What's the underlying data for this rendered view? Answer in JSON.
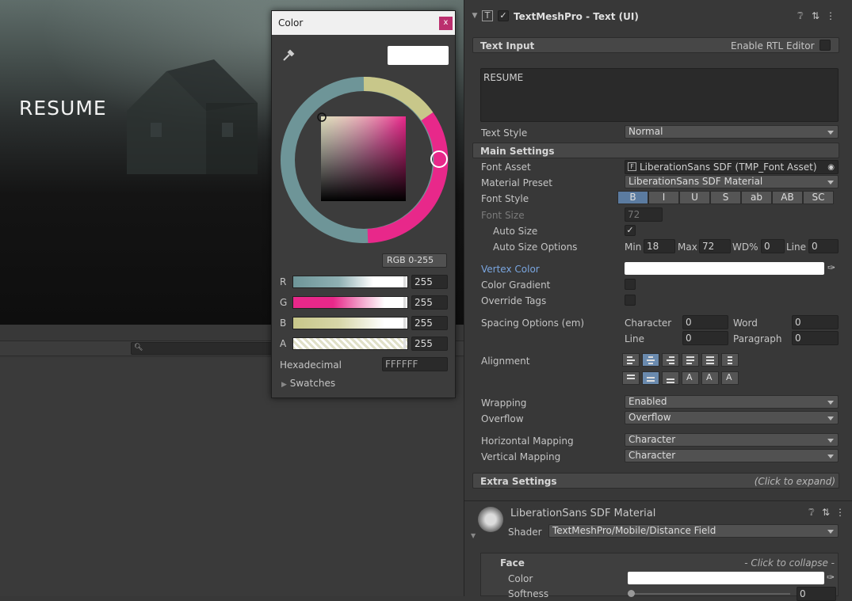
{
  "scene": {
    "overlay_text": "RESUME"
  },
  "color_picker": {
    "title": "Color",
    "close_label": "x",
    "mode": "RGB 0-255",
    "channels": [
      {
        "label": "R",
        "value": "255"
      },
      {
        "label": "G",
        "value": "255"
      },
      {
        "label": "B",
        "value": "255"
      },
      {
        "label": "A",
        "value": "255"
      }
    ],
    "hex_label": "Hexadecimal",
    "hex_value": "FFFFFF",
    "swatches_label": "Swatches",
    "colors": {
      "ring_teal": "#6e9598",
      "ring_yellow": "#c8c78a",
      "ring_pink": "#e8288a"
    }
  },
  "inspector": {
    "component_title": "TextMeshPro - Text (UI)",
    "text_input_header": "Text Input",
    "enable_rtl_label": "Enable RTL Editor",
    "text_value": "RESUME",
    "text_style_label": "Text Style",
    "text_style_value": "Normal",
    "main_settings_header": "Main Settings",
    "font_asset_label": "Font Asset",
    "font_asset_value": "LiberationSans SDF (TMP_Font Asset)",
    "material_preset_label": "Material Preset",
    "material_preset_value": "LiberationSans SDF Material",
    "font_style_label": "Font Style",
    "font_style_buttons": [
      "B",
      "I",
      "U",
      "S",
      "ab",
      "AB",
      "SC"
    ],
    "font_size_label": "Font Size",
    "font_size_value": "72",
    "auto_size_label": "Auto Size",
    "auto_size_options_label": "Auto Size Options",
    "auto_size": {
      "min_label": "Min",
      "min": "18",
      "max_label": "Max",
      "max": "72",
      "wd_label": "WD%",
      "wd": "0",
      "line_label": "Line",
      "line": "0"
    },
    "vertex_color_label": "Vertex Color",
    "color_gradient_label": "Color Gradient",
    "override_tags_label": "Override Tags",
    "spacing_label": "Spacing Options (em)",
    "spacing": {
      "character_label": "Character",
      "character": "0",
      "word_label": "Word",
      "word": "0",
      "line_label": "Line",
      "line": "0",
      "paragraph_label": "Paragraph",
      "paragraph": "0"
    },
    "alignment_label": "Alignment",
    "wrapping_label": "Wrapping",
    "wrapping_value": "Enabled",
    "overflow_label": "Overflow",
    "overflow_value": "Overflow",
    "h_mapping_label": "Horizontal Mapping",
    "h_mapping_value": "Character",
    "v_mapping_label": "Vertical Mapping",
    "v_mapping_value": "Character",
    "extra_settings_header": "Extra Settings",
    "extra_settings_hint": "(Click to expand)",
    "material_title": "LiberationSans SDF Material",
    "shader_label": "Shader",
    "shader_value": "TextMeshPro/Mobile/Distance Field",
    "face_header": "Face",
    "face_hint": "- Click to collapse -",
    "face_color_label": "Color",
    "softness_label": "Softness",
    "softness_value": "0"
  }
}
